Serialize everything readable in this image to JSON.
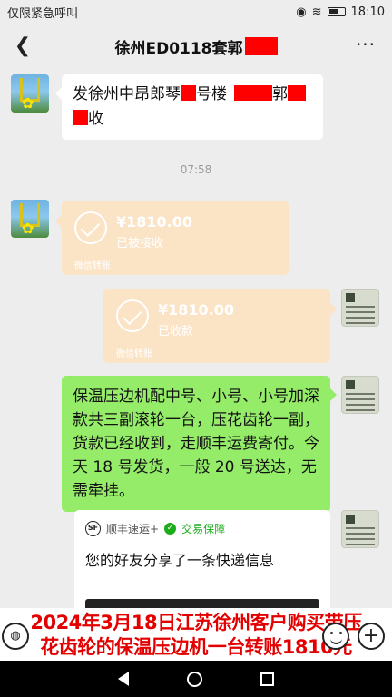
{
  "status_bar": {
    "carrier": "仅限紧急呼叫",
    "time": "18:10"
  },
  "header": {
    "title": "徐州ED0118套郭"
  },
  "messages": {
    "address": {
      "line1_a": "发徐州中昂郎琴",
      "line1_b": "号楼",
      "line1_c": "郭",
      "line2": "收"
    },
    "timestamp": "07:58",
    "transfer_received": {
      "amount": "¥1810.00",
      "status": "已被接收",
      "source": "微信转账"
    },
    "transfer_sent": {
      "amount": "¥1810.00",
      "status": "已收款",
      "source": "微信转账"
    },
    "text_green": "保温压边机配中号、小号、小号加深款共三副滚轮一台，压花齿轮一副，货款已经收到，走顺丰运费寄付。今天 18 号发货，一般 20 号送达，无需牵挂。",
    "share": {
      "brand": "顺丰速运+",
      "badge": "交易保障",
      "desc": "您的好友分享了一条快递信息"
    }
  },
  "caption": {
    "line1": "2024年3月18日江苏徐州客户购买带压",
    "line2": "花齿轮的保温压边机一台转账1810元"
  },
  "colors": {
    "accent_green": "#95ec69",
    "transfer_orange": "#fbe3c6",
    "caption_red": "#e30000",
    "redact_red": "#ff0000"
  }
}
